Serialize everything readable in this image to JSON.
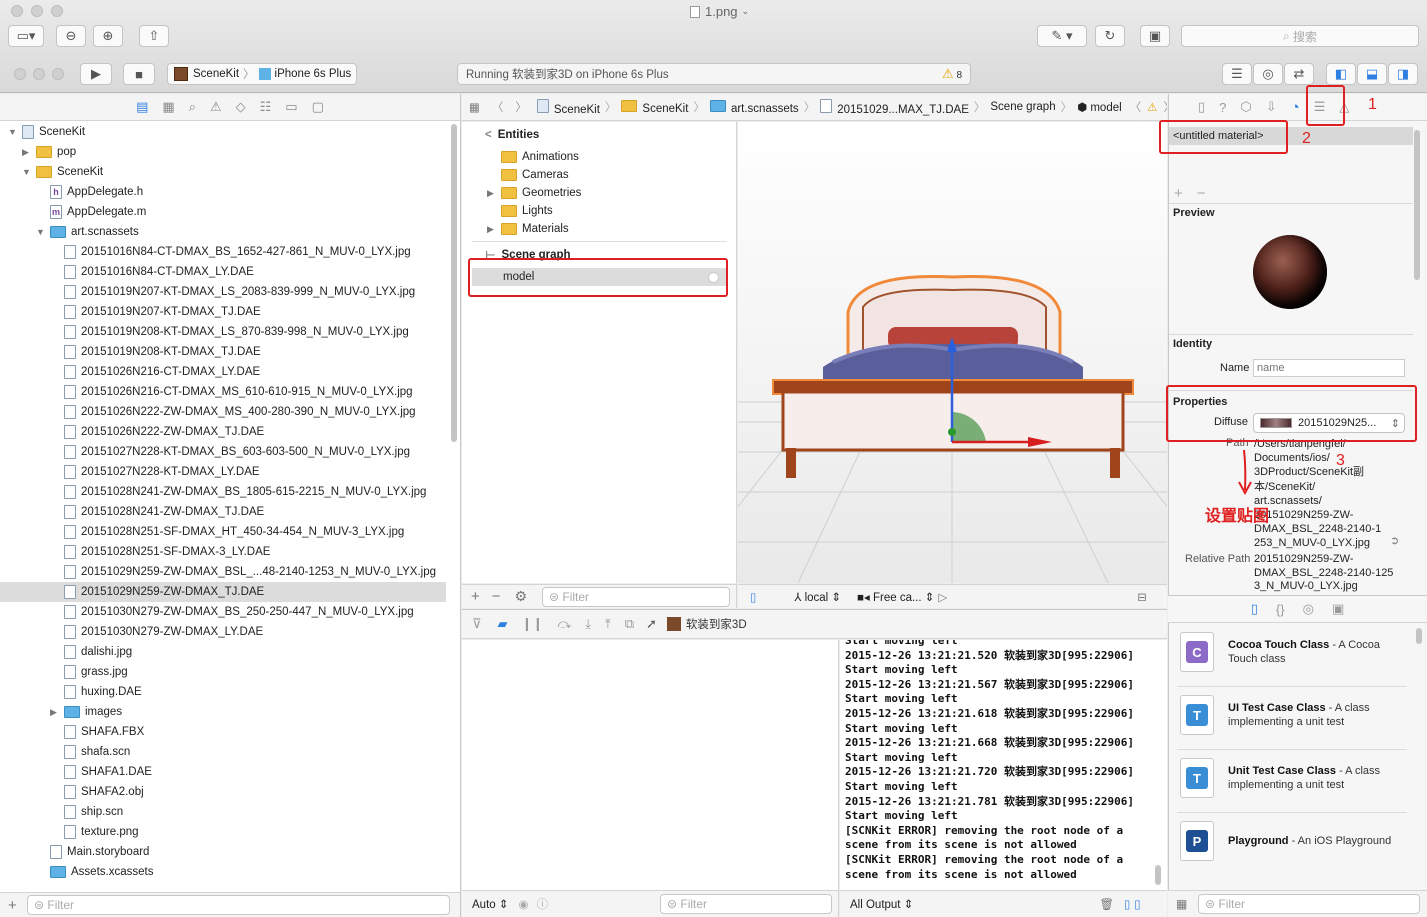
{
  "window": {
    "title": "1.png"
  },
  "toolbar": {
    "search_placeholder": "搜索",
    "scheme": "SceneKit",
    "device": "iPhone 6s Plus",
    "status": "Running 软装到家3D on iPhone 6s Plus",
    "warn_count": "8"
  },
  "navigator": {
    "items": [
      {
        "label": "SceneKit",
        "depth": 0,
        "kind": "project",
        "tri": "▼"
      },
      {
        "label": "pop",
        "depth": 1,
        "kind": "folder",
        "tri": "▶"
      },
      {
        "label": "SceneKit",
        "depth": 1,
        "kind": "folder",
        "tri": "▼"
      },
      {
        "label": "AppDelegate.h",
        "depth": 2,
        "kind": "h",
        "tri": ""
      },
      {
        "label": "AppDelegate.m",
        "depth": 2,
        "kind": "m",
        "tri": ""
      },
      {
        "label": "art.scnassets",
        "depth": 2,
        "kind": "bluefolder",
        "tri": "▼"
      },
      {
        "label": "20151016N84-CT-DMAX_BS_1652-427-861_N_MUV-0_LYX.jpg",
        "depth": 3,
        "kind": "file",
        "tri": ""
      },
      {
        "label": "20151016N84-CT-DMAX_LY.DAE",
        "depth": 3,
        "kind": "file",
        "tri": ""
      },
      {
        "label": "20151019N207-KT-DMAX_LS_2083-839-999_N_MUV-0_LYX.jpg",
        "depth": 3,
        "kind": "file",
        "tri": ""
      },
      {
        "label": "20151019N207-KT-DMAX_TJ.DAE",
        "depth": 3,
        "kind": "file",
        "tri": ""
      },
      {
        "label": "20151019N208-KT-DMAX_LS_870-839-998_N_MUV-0_LYX.jpg",
        "depth": 3,
        "kind": "file",
        "tri": ""
      },
      {
        "label": "20151019N208-KT-DMAX_TJ.DAE",
        "depth": 3,
        "kind": "file",
        "tri": ""
      },
      {
        "label": "20151026N216-CT-DMAX_LY.DAE",
        "depth": 3,
        "kind": "file",
        "tri": ""
      },
      {
        "label": "20151026N216-CT-DMAX_MS_610-610-915_N_MUV-0_LYX.jpg",
        "depth": 3,
        "kind": "file",
        "tri": ""
      },
      {
        "label": "20151026N222-ZW-DMAX_MS_400-280-390_N_MUV-0_LYX.jpg",
        "depth": 3,
        "kind": "file",
        "tri": ""
      },
      {
        "label": "20151026N222-ZW-DMAX_TJ.DAE",
        "depth": 3,
        "kind": "file",
        "tri": ""
      },
      {
        "label": "20151027N228-KT-DMAX_BS_603-603-500_N_MUV-0_LYX.jpg",
        "depth": 3,
        "kind": "file",
        "tri": ""
      },
      {
        "label": "20151027N228-KT-DMAX_LY.DAE",
        "depth": 3,
        "kind": "file",
        "tri": ""
      },
      {
        "label": "20151028N241-ZW-DMAX_BS_1805-615-2215_N_MUV-0_LYX.jpg",
        "depth": 3,
        "kind": "file",
        "tri": ""
      },
      {
        "label": "20151028N241-ZW-DMAX_TJ.DAE",
        "depth": 3,
        "kind": "file",
        "tri": ""
      },
      {
        "label": "20151028N251-SF-DMAX_HT_450-34-454_N_MUV-3_LYX.jpg",
        "depth": 3,
        "kind": "file",
        "tri": ""
      },
      {
        "label": "20151028N251-SF-DMAX-3_LY.DAE",
        "depth": 3,
        "kind": "file",
        "tri": ""
      },
      {
        "label": "20151029N259-ZW-DMAX_BSL_...48-2140-1253_N_MUV-0_LYX.jpg",
        "depth": 3,
        "kind": "file",
        "tri": ""
      },
      {
        "label": "20151029N259-ZW-DMAX_TJ.DAE",
        "depth": 3,
        "kind": "file",
        "tri": "",
        "selected": true
      },
      {
        "label": "20151030N279-ZW-DMAX_BS_250-250-447_N_MUV-0_LYX.jpg",
        "depth": 3,
        "kind": "file",
        "tri": ""
      },
      {
        "label": "20151030N279-ZW-DMAX_LY.DAE",
        "depth": 3,
        "kind": "file",
        "tri": ""
      },
      {
        "label": "dalishi.jpg",
        "depth": 3,
        "kind": "file",
        "tri": ""
      },
      {
        "label": "grass.jpg",
        "depth": 3,
        "kind": "file",
        "tri": ""
      },
      {
        "label": "huxing.DAE",
        "depth": 3,
        "kind": "file",
        "tri": ""
      },
      {
        "label": "images",
        "depth": 3,
        "kind": "bluefolder",
        "tri": "▶"
      },
      {
        "label": "SHAFA.FBX",
        "depth": 3,
        "kind": "file",
        "tri": ""
      },
      {
        "label": "shafa.scn",
        "depth": 3,
        "kind": "file",
        "tri": ""
      },
      {
        "label": "SHAFA1.DAE",
        "depth": 3,
        "kind": "file",
        "tri": ""
      },
      {
        "label": "SHAFA2.obj",
        "depth": 3,
        "kind": "file",
        "tri": ""
      },
      {
        "label": "ship.scn",
        "depth": 3,
        "kind": "file",
        "tri": ""
      },
      {
        "label": "texture.png",
        "depth": 3,
        "kind": "file",
        "tri": ""
      },
      {
        "label": "Main.storyboard",
        "depth": 2,
        "kind": "file",
        "tri": ""
      },
      {
        "label": "Assets.xcassets",
        "depth": 2,
        "kind": "bluefolder",
        "tri": ""
      }
    ],
    "filter_placeholder": "Filter"
  },
  "jumpbar": {
    "crumbs": [
      "SceneKit",
      "SceneKit",
      "art.scnassets",
      "20151029...MAX_TJ.DAE",
      "Scene graph",
      "model"
    ]
  },
  "scene_outline": {
    "entities_title": "Entities",
    "entities": [
      "Animations",
      "Cameras",
      "Geometries",
      "Lights",
      "Materials"
    ],
    "graph_title": "Scene graph",
    "node": "model",
    "filter_placeholder": "Filter"
  },
  "viewport": {
    "space": "local",
    "camera": "Free ca..."
  },
  "debug": {
    "process": "软装到家3D",
    "auto": "Auto",
    "all_output": "All Output",
    "filter_placeholder": "Filter"
  },
  "console": {
    "lines": [
      "Start moving left",
      "2015-12-26 13:21:21.520 软装到家3D[995:22906]",
      "Start moving left",
      "2015-12-26 13:21:21.567 软装到家3D[995:22906]",
      "Start moving left",
      "2015-12-26 13:21:21.618 软装到家3D[995:22906]",
      "Start moving left",
      "2015-12-26 13:21:21.668 软装到家3D[995:22906]",
      "Start moving left",
      "2015-12-26 13:21:21.720 软装到家3D[995:22906]",
      "Start moving left",
      "2015-12-26 13:21:21.781 软装到家3D[995:22906]",
      "Start moving left",
      "[SCNKit ERROR] removing the root node of a",
      "scene from its scene is not allowed",
      "[SCNKit ERROR] removing the root node of a",
      "scene from its scene is not allowed"
    ]
  },
  "inspector": {
    "material": "<untitled material>",
    "preview_title": "Preview",
    "identity_title": "Identity",
    "name_label": "Name",
    "name_placeholder": "name",
    "properties_title": "Properties",
    "diffuse_label": "Diffuse",
    "diffuse_value": "20151029N25...",
    "path_label": "Path",
    "path_value": "/Users/tianpengfei/\nDocuments/ios/\n3DProduct/SceneKit副\n本/SceneKit/\nart.scnassets/\n20151029N259-ZW-\nDMAX_BSL_2248-2140-1\n253_N_MUV-0_LYX.jpg",
    "relpath_label": "Relative Path",
    "relpath_value": "20151029N259-ZW-\nDMAX_BSL_2248-2140-125\n3_N_MUV-0_LYX.jpg"
  },
  "annotations": {
    "n1": "1",
    "n2": "2",
    "n3": "3",
    "hint": "设置贴图"
  },
  "library": {
    "items": [
      {
        "title": "Cocoa Touch Class",
        "desc": " - A Cocoa Touch class",
        "icon": "C",
        "color": "#8c6ac8"
      },
      {
        "title": "UI Test Case Class",
        "desc": " - A class implementing a unit test",
        "icon": "T",
        "color": "#3a8ed6"
      },
      {
        "title": "Unit Test Case Class",
        "desc": " - A class implementing a unit test",
        "icon": "T",
        "color": "#3a8ed6"
      },
      {
        "title": "Playground",
        "desc": " - An iOS Playground",
        "icon": "P",
        "color": "#1c4f94"
      }
    ],
    "filter_placeholder": "Filter"
  },
  "colors": {
    "accent": "#2f7fe0",
    "annotation_red": "#e02020",
    "selection": "#dcdcdc"
  }
}
